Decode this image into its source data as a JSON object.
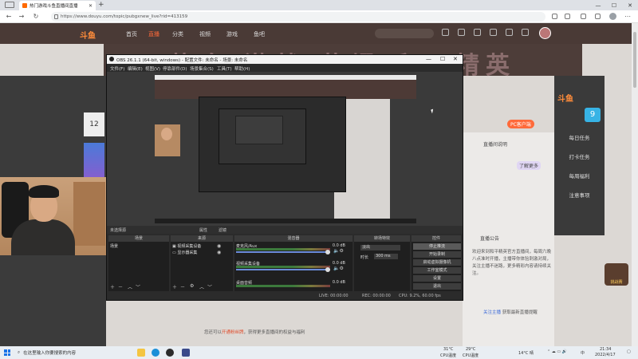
{
  "browser": {
    "tab_title": "热门游戏斗鱼直播间直播",
    "url": "https://www.douyu.com/topic/pubgxnew_live?rid=413159",
    "new_tab": "+"
  },
  "douyu": {
    "logo": "斗鱼",
    "nav": [
      "首页",
      "直播",
      "分类",
      "视频",
      "游戏",
      "鱼吧"
    ],
    "banner": "热血·激战·荣耀·和平精英",
    "left_card_number": "12",
    "side_rail": {
      "logo": "斗鱼",
      "badge": "9",
      "items": [
        "每日任务",
        "打卡任务",
        "每周福利",
        "注意事项"
      ]
    },
    "right_panel": {
      "button": "PC客户端",
      "row1": "直播间说明",
      "row2": "了解更多",
      "notice_title": "直播公告",
      "notice_text": "欢迎来到和平精英官方直播间，每周六晚八点准时开播，主播带你体验刺激对局，关注主播不迷路，更多精彩内容请持续关注。",
      "follow_link": "关注主播",
      "follow_text": "获取最新直播提醒"
    },
    "toast": "您还可以",
    "toast_em": "开通粉丝牌",
    "toast_tail": "，获得更多直播间的权益与福利",
    "trophy_label": "挑战赛"
  },
  "obs": {
    "title": "OBS 26.1.1 (64-bit, windows) - 配置文件: 未命名 - 场景: 未命名",
    "menu": [
      "文件(F)",
      "编辑(E)",
      "视图(V)",
      "停靠部件(D)",
      "场景集合(S)",
      "工具(T)",
      "帮助(H)"
    ],
    "label_bar": [
      "未选择源",
      "属性",
      "滤镜"
    ],
    "docks": [
      "场景",
      "来源",
      "混音器",
      "转场特效",
      "控件"
    ],
    "scenes": [
      "场景"
    ],
    "sources": [
      "视频采集设备",
      "显示器采集"
    ],
    "mixer": [
      {
        "name": "麦克风/Aux",
        "db": "0.0 dB"
      },
      {
        "name": "视频采集设备",
        "db": "0.0 dB"
      },
      {
        "name": "桌面音频",
        "db": "0.0 dB"
      }
    ],
    "transition": {
      "type": "淡出",
      "duration_label": "时长",
      "duration": "300 ms"
    },
    "controls": [
      "停止推流",
      "开始录制",
      "启动虚拟摄像机",
      "工作室模式",
      "设置",
      "退出"
    ],
    "status": {
      "live": "LIVE: 00:00:00",
      "rec": "REC: 00:00:00",
      "cpu": "CPU: 9.2%, 60.00 fps"
    }
  },
  "taskbar": {
    "search_placeholder": "在这里输入你要搜索的内容",
    "weather1_temp": "31°C",
    "weather1_label": "CPU温度",
    "weather2_temp": "29°C",
    "weather2_label": "CPU温度",
    "weather3": "14°C 晴",
    "time": "21:34",
    "date": "2022/4/17",
    "lang": "中"
  },
  "colors": {
    "accent": "#ff6a3a",
    "obs_bg": "#2b2b2b",
    "page_bg": "#dcd8d4"
  }
}
